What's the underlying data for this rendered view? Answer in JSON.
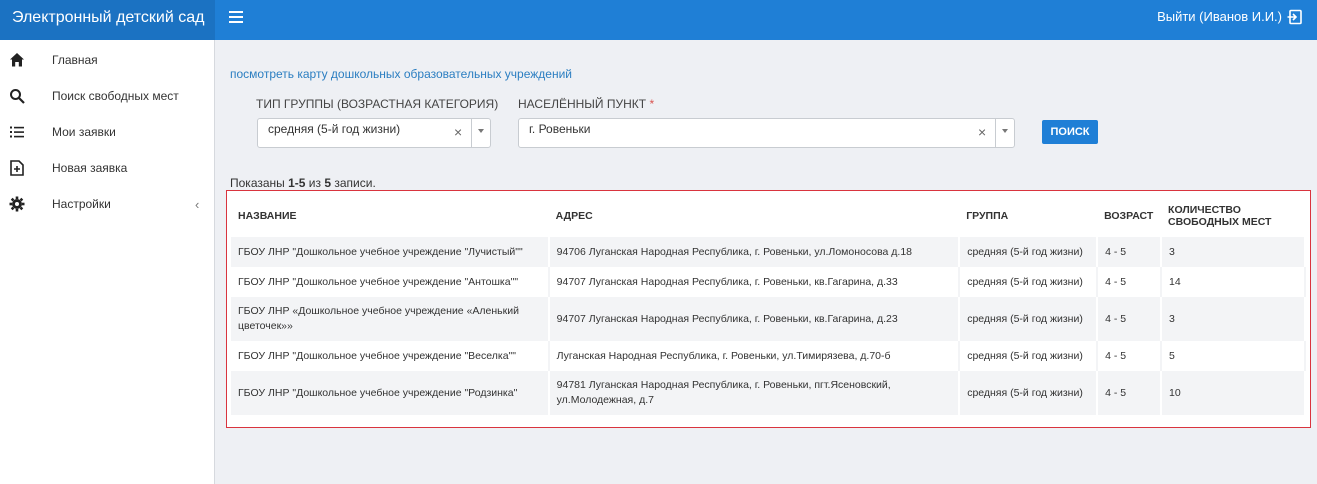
{
  "app": {
    "title": "Электронный детский сад",
    "logout_label": "Выйти (Иванов И.И.)"
  },
  "sidebar": {
    "items": [
      {
        "label": "Главная",
        "icon": "home-icon"
      },
      {
        "label": "Поиск свободных мест",
        "icon": "search-icon"
      },
      {
        "label": "Мои заявки",
        "icon": "list-icon"
      },
      {
        "label": "Новая заявка",
        "icon": "new-file-icon"
      },
      {
        "label": "Настройки",
        "icon": "gear-icon",
        "chevron": "‹"
      }
    ]
  },
  "main": {
    "map_link": "посмотреть карту дошкольных образовательных учреждений",
    "filters": {
      "group_type": {
        "label": "ТИП ГРУППЫ (ВОЗРАСТНАЯ КАТЕГОРИЯ)",
        "value": "средняя (5-й год жизни)",
        "clear": "×"
      },
      "locality": {
        "label": "НАСЕЛЁННЫЙ ПУНКТ",
        "required_mark": "*",
        "value": "г. Ровеньки",
        "clear": "×"
      }
    },
    "search_button": "ПОИСК",
    "summary": {
      "prefix": "Показаны ",
      "range": "1-5",
      "middle": " из ",
      "total": "5",
      "suffix": " записи."
    },
    "table": {
      "headers": [
        "НАЗВАНИЕ",
        "АДРЕС",
        "ГРУППА",
        "ВОЗРАСТ",
        "КОЛИЧЕСТВО СВОБОДНЫХ МЕСТ"
      ],
      "rows": [
        [
          "ГБОУ ЛНР \"Дошкольное учебное учреждение \"Лучистый\"\"",
          "94706 Луганская Народная Республика, г. Ровеньки, ул.Ломоносова д.18",
          "средняя (5-й год жизни)",
          "4 - 5",
          "3"
        ],
        [
          "ГБОУ ЛНР \"Дошкольное учебное учреждение \"Антошка\"\"",
          "94707 Луганская Народная Республика, г. Ровеньки, кв.Гагарина, д.33",
          "средняя (5-й год жизни)",
          "4 - 5",
          "14"
        ],
        [
          "ГБОУ ЛНР «Дошкольное учебное учреждение «Аленький цветочек»»",
          "94707 Луганская Народная Республика, г. Ровеньки, кв.Гагарина, д.23",
          "средняя (5-й год жизни)",
          "4 - 5",
          "3"
        ],
        [
          "ГБОУ ЛНР \"Дошкольное учебное учреждение \"Веселка\"\"",
          "Луганская Народная Республика, г. Ровеньки, ул.Тимирязева, д.70-б",
          "средняя (5-й год жизни)",
          "4 - 5",
          "5"
        ],
        [
          "ГБОУ ЛНР \"Дошкольное учебное учреждение \"Родзинка\"",
          "94781 Луганская Народная Республика, г. Ровеньки, пгт.Ясеновский, ул.Молодежная, д.7",
          "средняя (5-й год жизни)",
          "4 - 5",
          "10"
        ]
      ]
    }
  },
  "colors": {
    "header": "#1f7fd6",
    "brand": "#1b72c2",
    "link": "#2b7ec1",
    "highlight_border": "#d9343e"
  }
}
